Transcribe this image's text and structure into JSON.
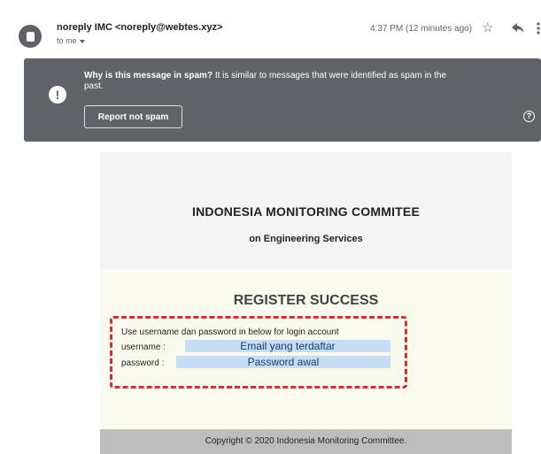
{
  "sender": {
    "name": "noreply IMC <noreply@webtes.xyz>",
    "recipient": "to me",
    "timestamp": "4:37 PM (12 minutes ago)"
  },
  "spam_banner": {
    "heading": "Why is this message in spam?",
    "message": " It is similar to messages that were identified as spam in the past.",
    "report_button": "Report not spam"
  },
  "email": {
    "org_title": "INDONESIA MONITORING COMMITEE",
    "org_subtitle": "on Engineering Services",
    "register_title": "REGISTER SUCCESS",
    "instructions": "Use username dan password in below for login account",
    "username_label": "username :",
    "username_value": "Email yang terdaftar",
    "password_label": "password :",
    "password_value": "Password awal",
    "footer": "Copyright © 2020 Indonesia Monitoring Committee."
  },
  "icons": {
    "avatar": "avatar-icon",
    "star": "star-icon",
    "reply": "reply-icon",
    "more": "more-vert-icon",
    "warning": "warning-icon",
    "help": "help-icon"
  },
  "colors": {
    "banner_background": "#5f6368",
    "highlight_box": "#d32f2f",
    "masked_value_background": "#c5def5"
  }
}
